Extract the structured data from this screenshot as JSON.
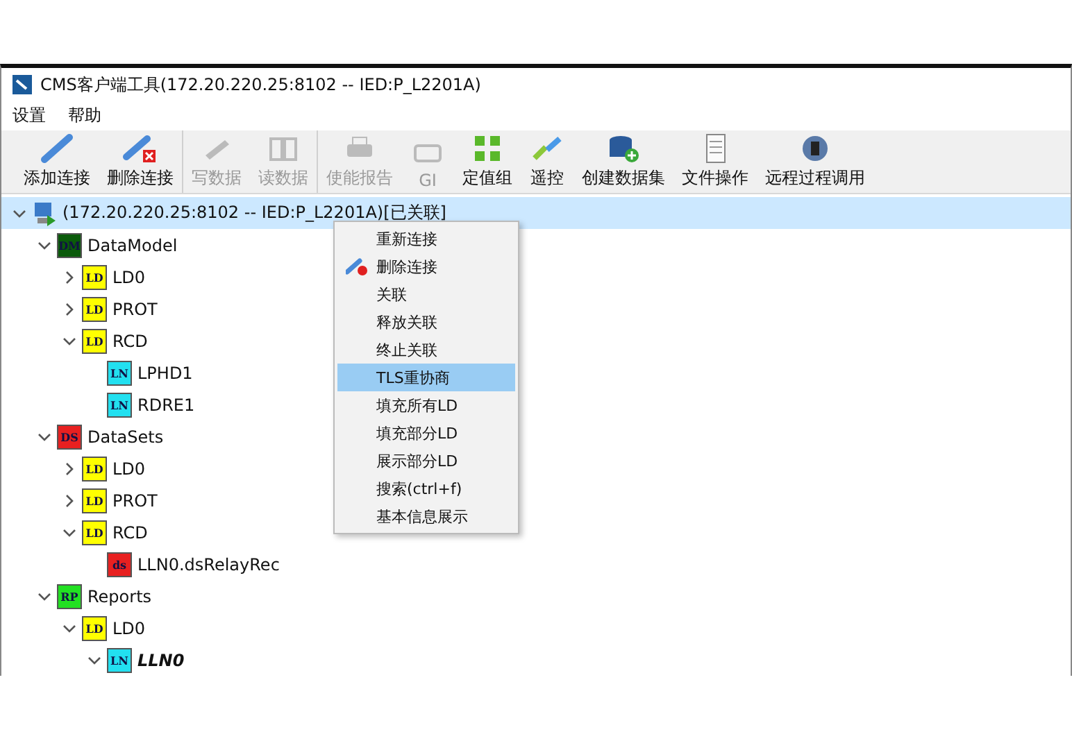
{
  "window": {
    "title": "CMS客户端工具(172.20.220.25:8102 -- IED:P_L2201A)"
  },
  "menu_bar": [
    "设置",
    "帮助"
  ],
  "toolbar": [
    {
      "buttons": [
        {
          "label": "添加连接",
          "disabled": false
        },
        {
          "label": "删除连接",
          "disabled": false
        }
      ]
    },
    {
      "buttons": [
        {
          "label": "写数据",
          "disabled": true
        },
        {
          "label": "读数据",
          "disabled": true
        }
      ]
    },
    {
      "buttons": [
        {
          "label": "使能报告",
          "disabled": true
        },
        {
          "label": "GI",
          "disabled": true
        },
        {
          "label": "定值组",
          "disabled": false
        },
        {
          "label": "遥控",
          "disabled": false
        },
        {
          "label": "创建数据集",
          "disabled": false
        },
        {
          "label": "文件操作",
          "disabled": false
        },
        {
          "label": "远程过程调用",
          "disabled": false
        }
      ]
    }
  ],
  "tree": [
    {
      "label": "(172.20.220.25:8102 -- IED:P_L2201A)[已关联]",
      "kind": "server",
      "expanded": true,
      "selected": true,
      "children": [
        {
          "label": "DataModel",
          "badge": "DM",
          "color": "#0a5a0a",
          "expanded": true,
          "selected": false,
          "children": [
            {
              "label": "LD0",
              "badge": "LD",
              "color": "#ffff00",
              "expanded": false,
              "selected": false
            },
            {
              "label": "PROT",
              "badge": "LD",
              "color": "#ffff00",
              "expanded": false,
              "selected": false
            },
            {
              "label": "RCD",
              "badge": "LD",
              "color": "#ffff00",
              "expanded": true,
              "selected": false,
              "children": [
                {
                  "label": "LPHD1",
                  "badge": "LN",
                  "color": "#22e0f0",
                  "selected": false
                },
                {
                  "label": "RDRE1",
                  "badge": "LN",
                  "color": "#22e0f0",
                  "selected": false
                }
              ]
            }
          ]
        },
        {
          "label": "DataSets",
          "badge": "DS",
          "color": "#e82020",
          "expanded": true,
          "selected": false,
          "children": [
            {
              "label": "LD0",
              "badge": "LD",
              "color": "#ffff00",
              "expanded": false,
              "selected": false
            },
            {
              "label": "PROT",
              "badge": "LD",
              "color": "#ffff00",
              "expanded": false,
              "selected": false
            },
            {
              "label": "RCD",
              "badge": "LD",
              "color": "#ffff00",
              "expanded": true,
              "selected": false,
              "children": [
                {
                  "label": "LLN0.dsRelayRec",
                  "badge": "ds",
                  "color": "#e82020",
                  "selected": false
                }
              ]
            }
          ]
        },
        {
          "label": "Reports",
          "badge": "RP",
          "color": "#22e022",
          "expanded": true,
          "selected": false,
          "children": [
            {
              "label": "LD0",
              "badge": "LD",
              "color": "#ffff00",
              "expanded": true,
              "selected": false,
              "children": [
                {
                  "label": "LLN0",
                  "badge": "LN",
                  "color": "#22e0f0",
                  "expanded": true,
                  "emphasized": true,
                  "selected": false
                }
              ]
            }
          ]
        }
      ]
    }
  ],
  "context_menu": [
    {
      "label": "重新连接",
      "kind": "plain",
      "selected": false
    },
    {
      "label": "删除连接",
      "kind": "with-icon",
      "selected": false
    },
    {
      "label": "关联",
      "kind": "plain",
      "selected": false
    },
    {
      "label": "释放关联",
      "kind": "plain",
      "selected": false
    },
    {
      "label": "终止关联",
      "kind": "plain",
      "selected": false
    },
    {
      "label": "TLS重协商",
      "kind": "plain",
      "selected": true
    },
    {
      "label": "填充所有LD",
      "kind": "plain",
      "selected": false
    },
    {
      "label": "填充部分LD",
      "kind": "plain",
      "selected": false
    },
    {
      "label": "展示部分LD",
      "kind": "plain",
      "selected": false
    },
    {
      "label": "搜索(ctrl+f)",
      "kind": "plain",
      "selected": false
    },
    {
      "label": "基本信息展示",
      "kind": "plain",
      "selected": false
    }
  ]
}
